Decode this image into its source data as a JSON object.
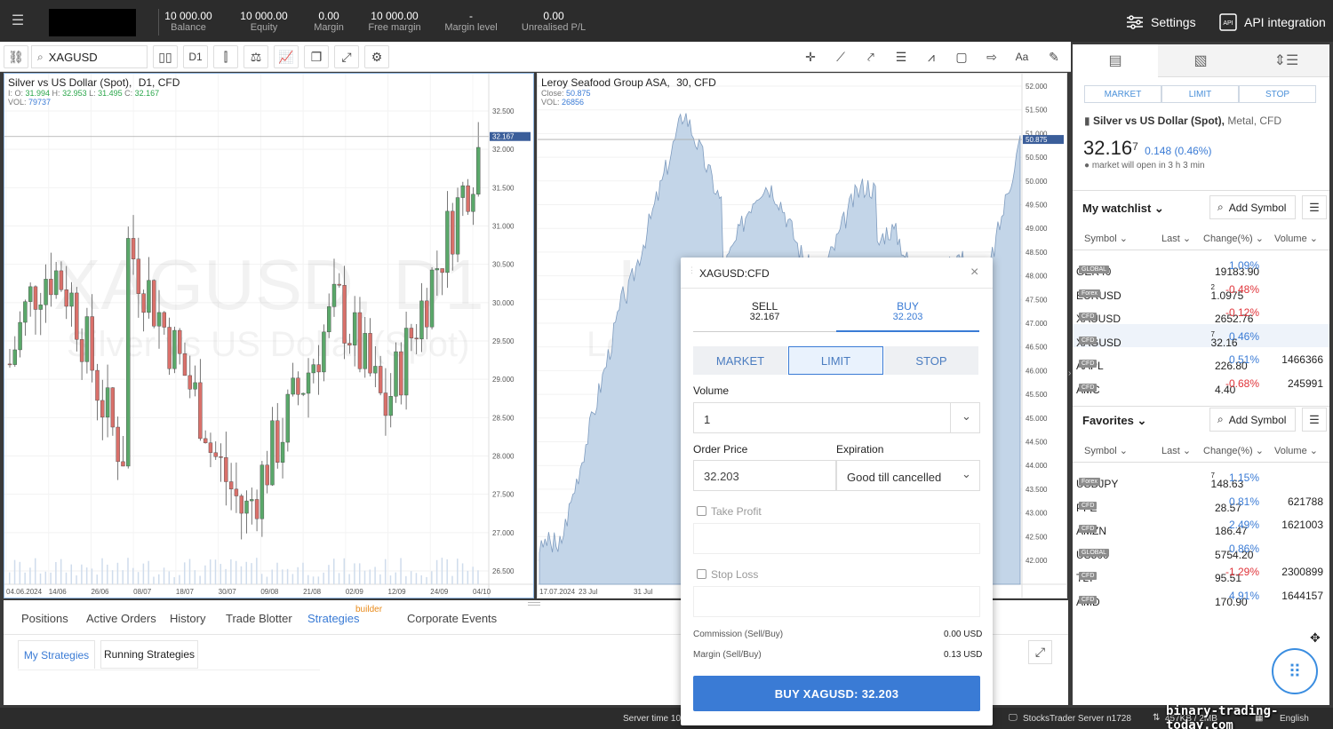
{
  "topbar": {
    "menu_icon": "hamburger-icon",
    "stats": [
      {
        "value": "10 000.00",
        "label": "Balance"
      },
      {
        "value": "10 000.00",
        "label": "Equity"
      },
      {
        "value": "0.00",
        "label": "Margin"
      },
      {
        "value": "10 000.00",
        "label": "Free margin"
      },
      {
        "value": "-",
        "label": "Margin level"
      },
      {
        "value": "0.00",
        "label": "Unrealised P/L"
      }
    ],
    "settings_label": "Settings",
    "api_label": "API integration"
  },
  "toolbar": {
    "symbol": "XAGUSD",
    "timeframe": "D1",
    "text_tool": "Aa"
  },
  "chart_left": {
    "title": "Silver vs US Dollar (Spot),",
    "title_meta": "D1,  CFD",
    "ohlc": {
      "o": "31.994",
      "h": "32.953",
      "l": "31.495",
      "c": "32.167"
    },
    "vol": "79737",
    "watermark_1": "XAGUSD, D1",
    "watermark_2": "Silver vs US Dollar (Spot)",
    "price_tag": "32.167",
    "y_ticks": [
      "32.500",
      "32.000",
      "31.500",
      "31.000",
      "30.500",
      "30.000",
      "29.500",
      "29.000",
      "28.500",
      "28.000",
      "27.500",
      "27.000",
      "26.500"
    ],
    "x_ticks": [
      "04.06.2024",
      "14/06",
      "26/06",
      "08/07",
      "18/07",
      "30/07",
      "09/08",
      "21/08",
      "02/09",
      "12/09",
      "24/09",
      "04/10"
    ]
  },
  "chart_right": {
    "title": "Leroy Seafood Group ASA,",
    "title_meta": "30,  CFD",
    "close": "50.875",
    "vol": "26856",
    "watermark_1": "LSG",
    "watermark_2": "Leroy",
    "price_tag": "50.875",
    "y_ticks": [
      "52.000",
      "51.500",
      "51.000",
      "50.500",
      "50.000",
      "49.500",
      "49.000",
      "48.500",
      "48.000",
      "47.500",
      "47.000",
      "46.500",
      "46.000",
      "45.500",
      "45.000",
      "44.500",
      "44.000",
      "43.500",
      "43.000",
      "42.500",
      "42.000"
    ],
    "x_ticks": [
      "17.07.2024",
      "23 Jul",
      "31 Jul"
    ]
  },
  "bottom": {
    "tabs": [
      "Positions",
      "Active Orders",
      "History",
      "Trade Blotter",
      "Strategies",
      "Corporate Events"
    ],
    "builder_badge": "builder",
    "subtabs": [
      "My Strategies",
      "Running Strategies"
    ]
  },
  "status": {
    "server_time": "Server time 10:",
    "server": "StocksTrader Server n1728",
    "traffic": "457KB / 2MB",
    "language": "English",
    "watermark": "binary-trading-today.com"
  },
  "right": {
    "order_tabs": [
      "MARKET",
      "LIMIT",
      "STOP"
    ],
    "instrument_name": "Silver vs US Dollar (Spot),",
    "instrument_meta": "Metal, CFD",
    "price_main": "32.16",
    "price_sup": "7",
    "change": "0.148 (0.46%)",
    "market_note": "market will open in 3 h 3 min",
    "watchlist_title": "My watchlist",
    "favorites_title": "Favorites",
    "add_symbol": "Add Symbol",
    "columns": [
      "Symbol",
      "Last",
      "Change(%)",
      "Volume"
    ],
    "watchlist": [
      {
        "symbol": "GER40",
        "tag": "GLOBAL",
        "last": "19183.90",
        "sup": "",
        "change": "1.09%",
        "volume": "",
        "dir": "pos"
      },
      {
        "symbol": "EURUSD",
        "tag": "Forex",
        "last": "1.0975",
        "sup": "2",
        "change": "-0.48%",
        "volume": "",
        "dir": "neg"
      },
      {
        "symbol": "XAUUSD",
        "tag": "CFD",
        "last": "2652.76",
        "sup": "",
        "change": "-0.12%",
        "volume": "",
        "dir": "neg"
      },
      {
        "symbol": "XAGUSD",
        "tag": "CFD",
        "last": "32.16",
        "sup": "7",
        "change": "0.46%",
        "volume": "",
        "dir": "pos"
      },
      {
        "symbol": "AAPL",
        "tag": "CFD",
        "last": "226.80",
        "sup": "",
        "change": "0.51%",
        "volume": "1466366",
        "dir": "pos"
      },
      {
        "symbol": "AMC",
        "tag": "CFD",
        "last": "4.40",
        "sup": "",
        "change": "-0.68%",
        "volume": "245991",
        "dir": "neg"
      }
    ],
    "favorites": [
      {
        "symbol": "USDJPY",
        "tag": "Forex",
        "last": "148.63",
        "sup": "7",
        "change": "1.15%",
        "volume": "",
        "dir": "pos"
      },
      {
        "symbol": "PFE",
        "tag": "CFD",
        "last": "28.57",
        "sup": "",
        "change": "0.81%",
        "volume": "621788",
        "dir": "pos"
      },
      {
        "symbol": "AMZN",
        "tag": "CFD",
        "last": "186.47",
        "sup": "",
        "change": "2.49%",
        "volume": "1621003",
        "dir": "pos"
      },
      {
        "symbol": "US500",
        "tag": "GLOBAL",
        "last": "5754.20",
        "sup": "",
        "change": "0.86%",
        "volume": "",
        "dir": "pos"
      },
      {
        "symbol": "TLT",
        "tag": "CFD",
        "last": "95.51",
        "sup": "",
        "change": "-1.29%",
        "volume": "2300899",
        "dir": "neg"
      },
      {
        "symbol": "AMD",
        "tag": "CFD",
        "last": "170.90",
        "sup": "",
        "change": "4.91%",
        "volume": "1644157",
        "dir": "pos"
      }
    ]
  },
  "dialog": {
    "title": "XAGUSD:CFD",
    "sell_label": "SELL",
    "sell_price": "32.167",
    "buy_label": "BUY",
    "buy_price": "32.203",
    "order_types": [
      "MARKET",
      "LIMIT",
      "STOP"
    ],
    "volume_label": "Volume",
    "volume_value": "1",
    "order_price_label": "Order Price",
    "order_price_value": "32.203",
    "expiration_label": "Expiration",
    "expiration_value": "Good till cancelled",
    "take_profit_label": "Take Profit",
    "stop_loss_label": "Stop Loss",
    "commission_label": "Commission (Sell/Buy)",
    "commission_value": "0.00 USD",
    "margin_label": "Margin (Sell/Buy)",
    "margin_value": "0.13 USD",
    "submit_label": "BUY XAGUSD: 32.203"
  }
}
